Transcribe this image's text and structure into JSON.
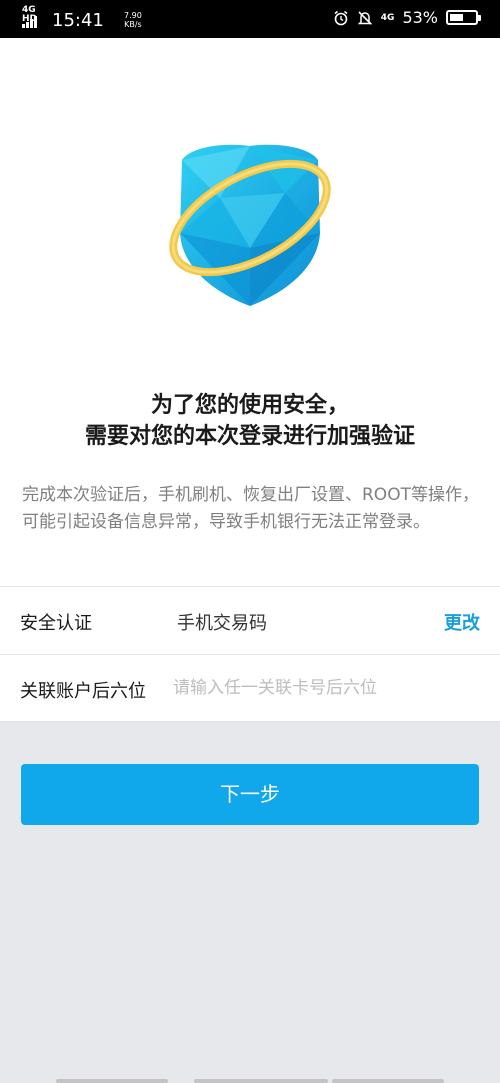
{
  "status_bar": {
    "network_type": "4G HD",
    "time": "15:41",
    "speed_value": "7.90",
    "speed_unit": "KB/s",
    "icons": [
      "alarm-icon",
      "notification-off-icon",
      "signal-4g-icon"
    ],
    "network_4g": "4G",
    "battery_percent": "53%",
    "battery_level": 0.53
  },
  "main": {
    "headline_line1": "为了您的使用安全，",
    "headline_line2": "需要对您的本次登录进行加强验证",
    "description": "完成本次验证后，手机刷机、恢复出厂设置、ROOT等操作，可能引起设备信息异常，导致手机银行无法正常登录。"
  },
  "form": {
    "security_label": "安全认证",
    "security_value": "手机交易码",
    "change_label": "更改",
    "account_label": "关联账户后六位",
    "account_placeholder": "请输入任一关联卡号后六位"
  },
  "actions": {
    "next_label": "下一步"
  },
  "colors": {
    "accent": "#11a7eb",
    "link": "#1aa0d8",
    "shield_blue": "#1fb8e8",
    "ring_gold": "#f2c94c"
  }
}
